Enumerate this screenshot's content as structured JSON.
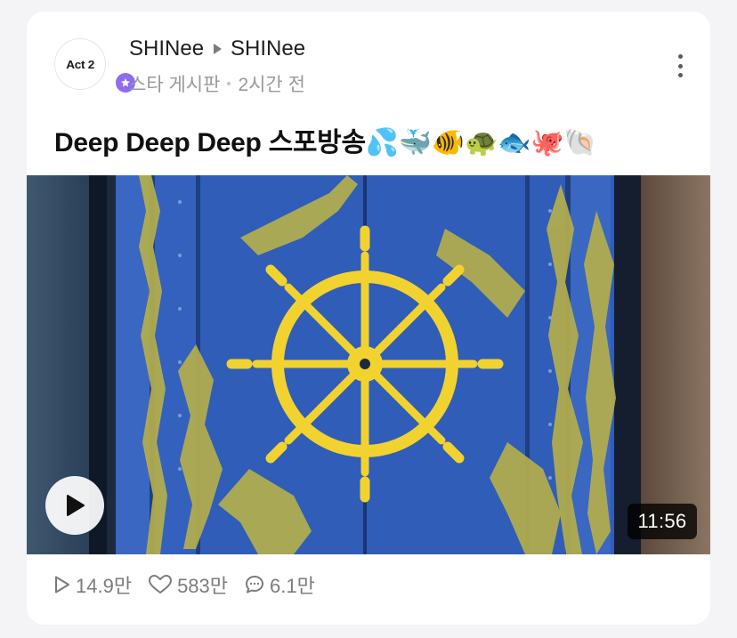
{
  "post": {
    "avatar_text": "Act 2",
    "community": "SHINee",
    "author": "SHINee",
    "board": "스타 게시판",
    "time_ago": "2시간 전",
    "title": "Deep Deep Deep 스포방송💦🐳🐠🐢🐟🐙🐚"
  },
  "video": {
    "duration": "11:56"
  },
  "stats": {
    "views": "14.9만",
    "likes": "583만",
    "comments": "6.1만"
  },
  "icons": {
    "badge": "star-icon",
    "menu": "more-vertical-icon",
    "play": "play-icon",
    "views": "play-outline-icon",
    "likes": "heart-outline-icon",
    "comments": "chat-bubble-icon"
  },
  "colors": {
    "badge_purple": "#8e6cf0",
    "panel_blue": "#2f5db8",
    "wheel_yellow": "#f2d22e",
    "moss": "#b7b04a"
  }
}
